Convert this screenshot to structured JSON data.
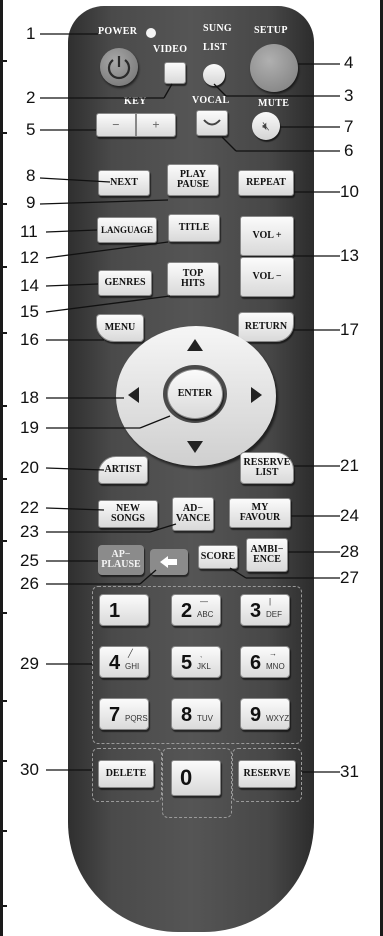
{
  "remote": {
    "labels": {
      "power": "POWER",
      "sung": "SUNG",
      "setup": "SETUP",
      "video": "VIDEO",
      "list": "LIST",
      "key": "KEY",
      "vocal": "VOCAL",
      "mute": "MUTE"
    },
    "buttons": {
      "key_minus": "−",
      "key_plus": "+",
      "next": "NEXT",
      "play_pause": "PLAY\nPAUSE",
      "repeat": "REPEAT",
      "language": "LANGUAGE",
      "title": "TITLE",
      "vol_plus": "VOL +",
      "vol_minus": "VOL −",
      "genres": "GENRES",
      "top_hits": "TOP\nHITS",
      "menu": "MENU",
      "return": "RETURN",
      "enter": "ENTER",
      "artist": "ARTIST",
      "reserve_list": "RESERVE\nLIST",
      "new_songs": "NEW\nSONGS",
      "advance": "AD−\nVANCE",
      "my_favour": "MY\nFAVOUR",
      "ap_pause": "AP−\nPLAUSE",
      "score": "SCORE",
      "ambience": "AMBI−\nENCE",
      "delete": "DELETE",
      "zero": "0",
      "reserve": "RESERVE"
    },
    "numpad": [
      {
        "digit": "1",
        "letters": "",
        "glyph": ""
      },
      {
        "digit": "2",
        "letters": "ABC",
        "glyph": "—"
      },
      {
        "digit": "3",
        "letters": "DEF",
        "glyph": "|"
      },
      {
        "digit": "4",
        "letters": "GHI",
        "glyph": "╱"
      },
      {
        "digit": "5",
        "letters": "JKL",
        "glyph": "ˎ"
      },
      {
        "digit": "6",
        "letters": "MNO",
        "glyph": "→"
      },
      {
        "digit": "7",
        "letters": "PQRS",
        "glyph": ""
      },
      {
        "digit": "8",
        "letters": "TUV",
        "glyph": ""
      },
      {
        "digit": "9",
        "letters": "WXYZ",
        "glyph": ""
      }
    ]
  },
  "callouts": {
    "c1": "1",
    "c2": "2",
    "c3": "3",
    "c4": "4",
    "c5": "5",
    "c6": "6",
    "c7": "7",
    "c8": "8",
    "c9": "9",
    "c10": "10",
    "c11": "11",
    "c12": "12",
    "c13": "13",
    "c14": "14",
    "c15": "15",
    "c16": "16",
    "c17": "17",
    "c18": "18",
    "c19": "19",
    "c20": "20",
    "c21": "21",
    "c22": "22",
    "c23": "23",
    "c24": "24",
    "c25": "25",
    "c26": "26",
    "c27": "27",
    "c28": "28",
    "c29": "29",
    "c30": "30",
    "c31": "31"
  }
}
